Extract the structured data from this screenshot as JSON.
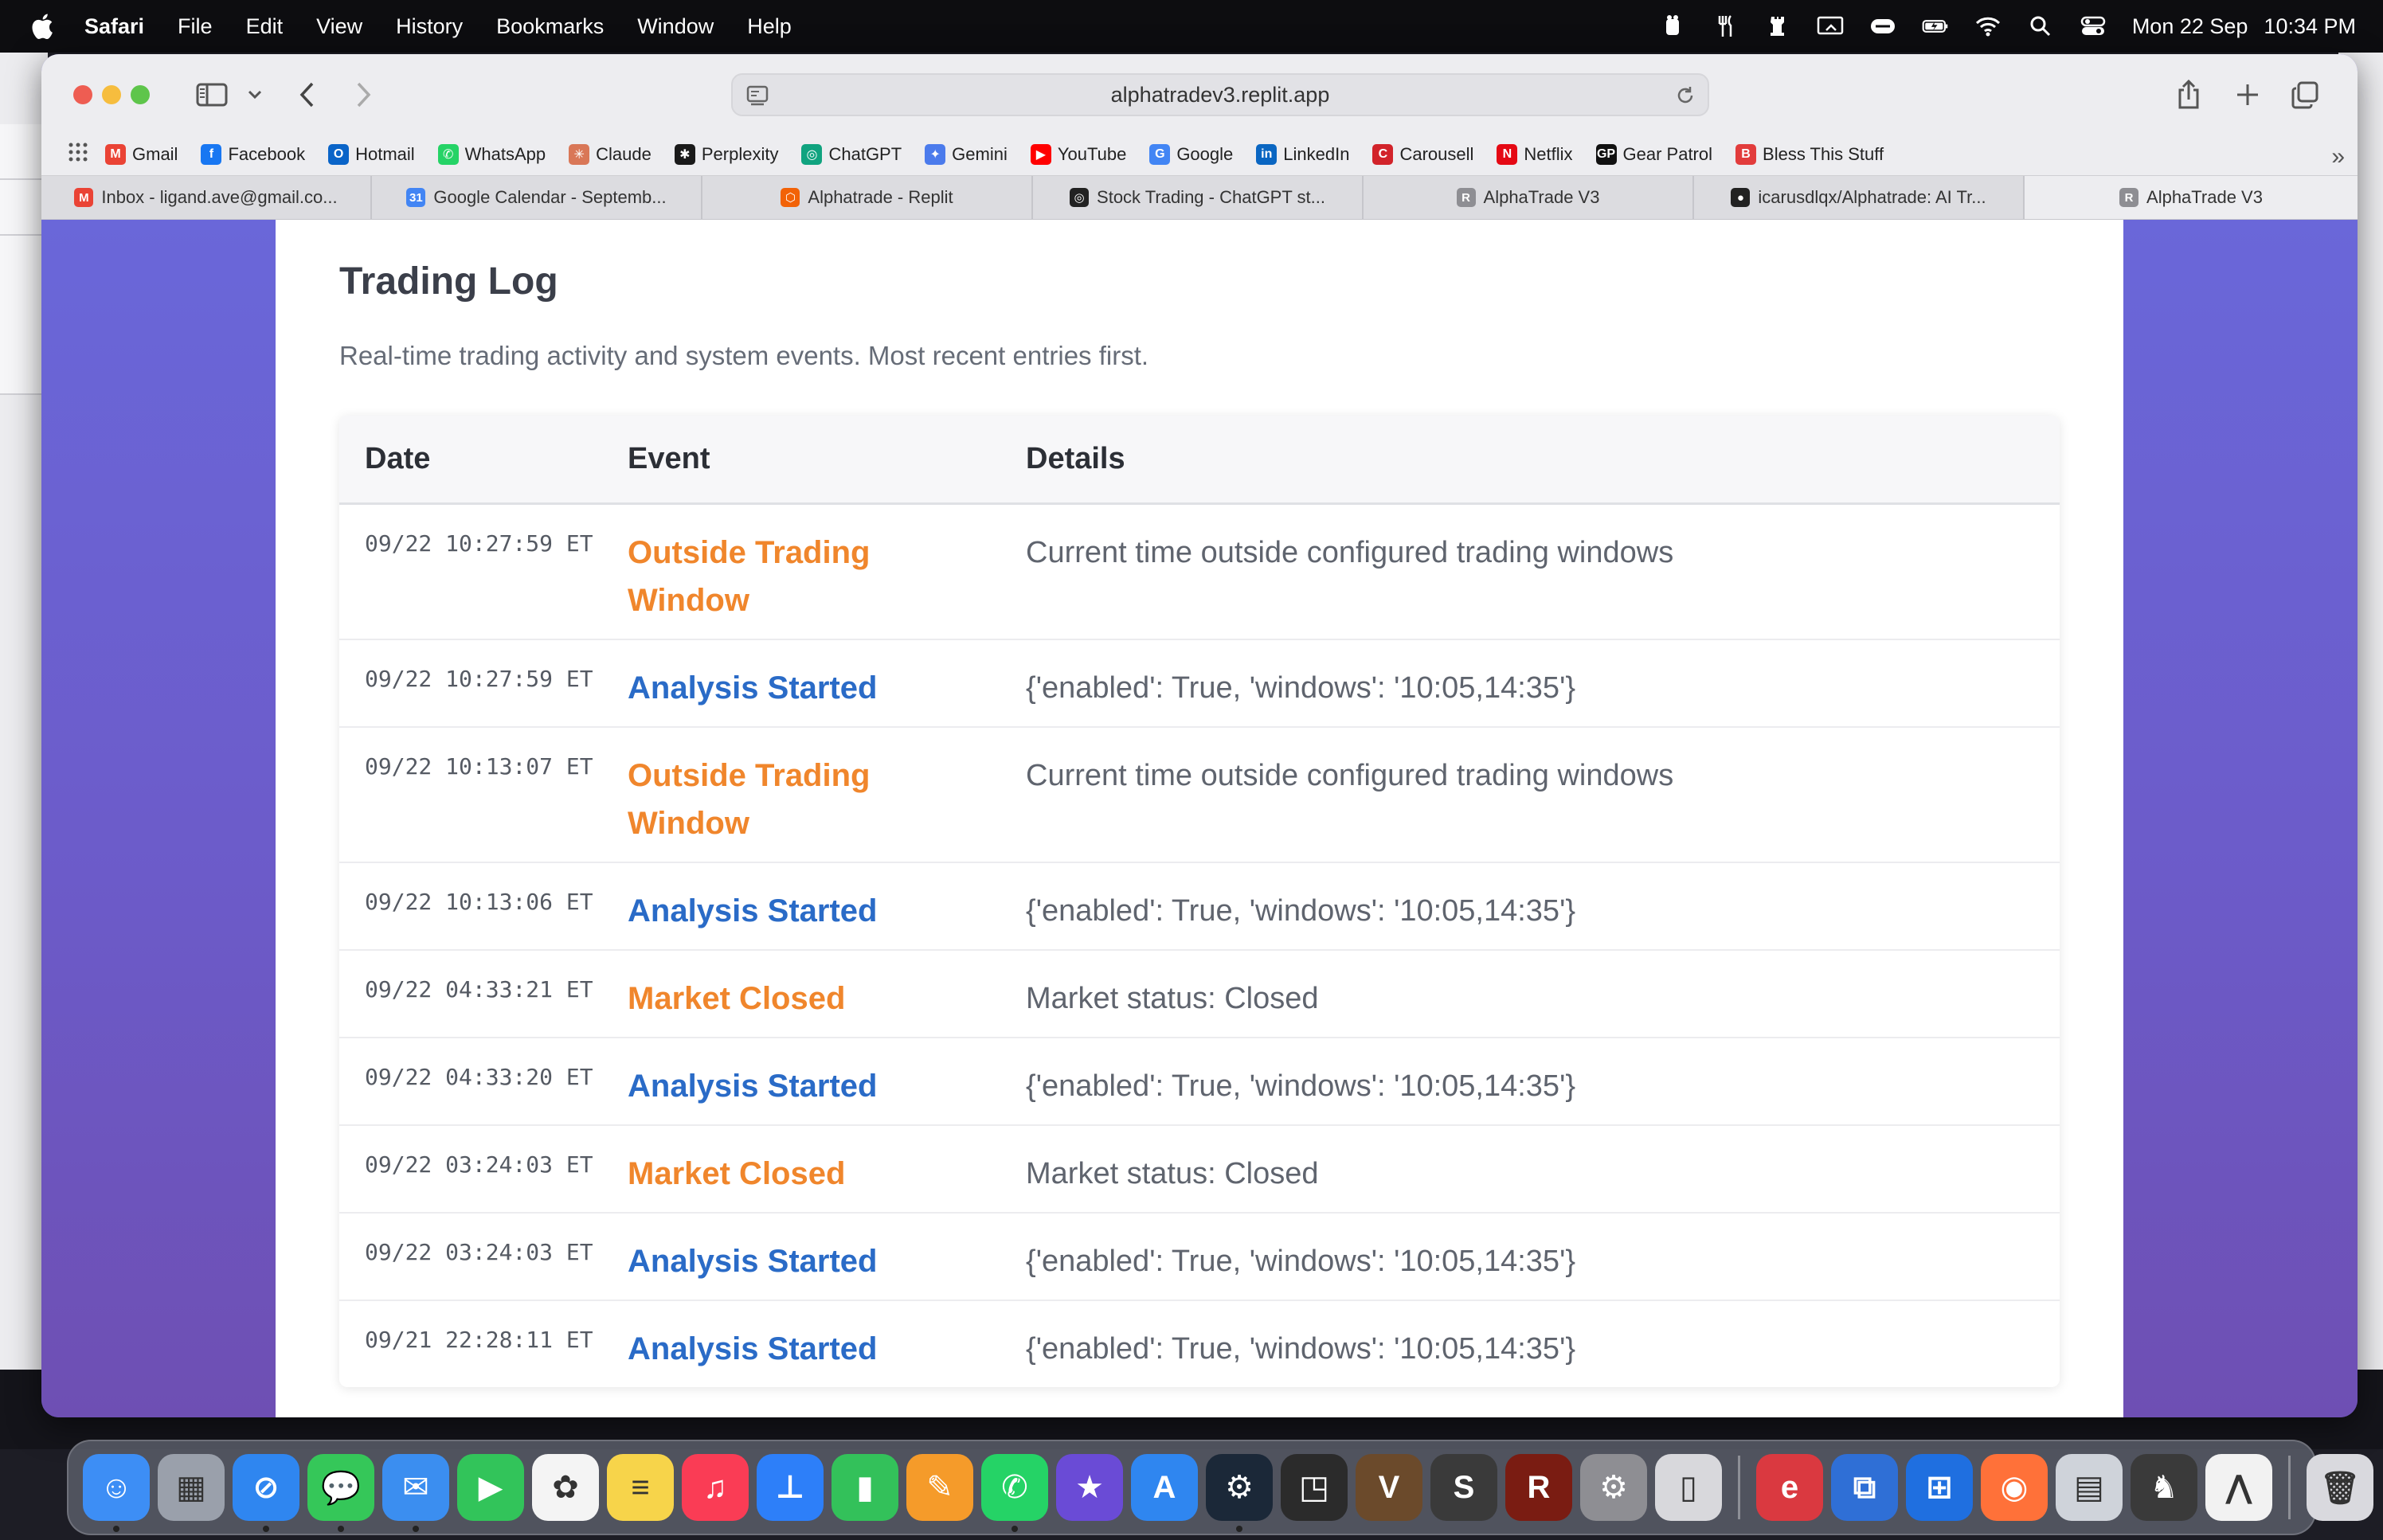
{
  "menubar": {
    "app": "Safari",
    "items": [
      "File",
      "Edit",
      "View",
      "History",
      "Bookmarks",
      "Window",
      "Help"
    ],
    "date": "Mon 22 Sep",
    "time": "10:34 PM"
  },
  "browser": {
    "url": "alphatradev3.replit.app",
    "bookmarks": [
      {
        "label": "Gmail",
        "icon": "gmail-icon",
        "color": "#ea4335",
        "glyph": "M"
      },
      {
        "label": "Facebook",
        "icon": "facebook-icon",
        "color": "#1877f2",
        "glyph": "f"
      },
      {
        "label": "Hotmail",
        "icon": "outlook-icon",
        "color": "#0a64c8",
        "glyph": "O"
      },
      {
        "label": "WhatsApp",
        "icon": "whatsapp-icon",
        "color": "#25d366",
        "glyph": "✆"
      },
      {
        "label": "Claude",
        "icon": "claude-icon",
        "color": "#d97757",
        "glyph": "✳"
      },
      {
        "label": "Perplexity",
        "icon": "perplexity-icon",
        "color": "#1a1a1a",
        "glyph": "✱"
      },
      {
        "label": "ChatGPT",
        "icon": "chatgpt-icon",
        "color": "#10a37f",
        "glyph": "◎"
      },
      {
        "label": "Gemini",
        "icon": "gemini-icon",
        "color": "#4b7bec",
        "glyph": "✦"
      },
      {
        "label": "YouTube",
        "icon": "youtube-icon",
        "color": "#ff0000",
        "glyph": "▶"
      },
      {
        "label": "Google",
        "icon": "google-icon",
        "color": "#4285f4",
        "glyph": "G"
      },
      {
        "label": "LinkedIn",
        "icon": "linkedin-icon",
        "color": "#0a66c2",
        "glyph": "in"
      },
      {
        "label": "Carousell",
        "icon": "carousell-icon",
        "color": "#d2232a",
        "glyph": "C"
      },
      {
        "label": "Netflix",
        "icon": "netflix-icon",
        "color": "#e50914",
        "glyph": "N"
      },
      {
        "label": "Gear Patrol",
        "icon": "gear-patrol-icon",
        "color": "#111111",
        "glyph": "GP"
      },
      {
        "label": "Bless This Stuff",
        "icon": "bless-this-stuff-icon",
        "color": "#e23c3c",
        "glyph": "B"
      }
    ],
    "tabs": [
      {
        "label": "Inbox - ligand.ave@gmail.co...",
        "icon": "gmail-icon",
        "color": "#ea4335",
        "glyph": "M"
      },
      {
        "label": "Google Calendar - Septemb...",
        "icon": "calendar-icon",
        "color": "#4285f4",
        "glyph": "31"
      },
      {
        "label": "Alphatrade - Replit",
        "icon": "replit-icon",
        "color": "#f26207",
        "glyph": "⬡"
      },
      {
        "label": "Stock Trading - ChatGPT st...",
        "icon": "chatgpt-icon",
        "color": "#222222",
        "glyph": "◎"
      },
      {
        "label": "AlphaTrade V3",
        "icon": "alphatrade-icon",
        "color": "#8e8e93",
        "glyph": "R"
      },
      {
        "label": "icarusdlqx/Alphatrade: AI Tr...",
        "icon": "github-icon",
        "color": "#222222",
        "glyph": "●"
      },
      {
        "label": "AlphaTrade V3",
        "icon": "alphatrade-icon",
        "color": "#8e8e93",
        "glyph": "R"
      }
    ]
  },
  "log": {
    "title": "Trading Log",
    "subtitle": "Real-time trading activity and system events. Most recent entries first.",
    "headers": {
      "date": "Date",
      "event": "Event",
      "details": "Details"
    },
    "colors": {
      "warning": "#f0862c",
      "info": "#2a6bc7"
    },
    "rows": [
      {
        "date": "09/22 10:27:59 ET",
        "event": "Outside Trading Window",
        "kind": "warning",
        "details": "Current time outside configured trading windows"
      },
      {
        "date": "09/22 10:27:59 ET",
        "event": "Analysis Started",
        "kind": "info",
        "details": "{'enabled': True, 'windows': '10:05,14:35'}"
      },
      {
        "date": "09/22 10:13:07 ET",
        "event": "Outside Trading Window",
        "kind": "warning",
        "details": "Current time outside configured trading windows"
      },
      {
        "date": "09/22 10:13:06 ET",
        "event": "Analysis Started",
        "kind": "info",
        "details": "{'enabled': True, 'windows': '10:05,14:35'}"
      },
      {
        "date": "09/22 04:33:21 ET",
        "event": "Market Closed",
        "kind": "warning",
        "details": "Market status: Closed"
      },
      {
        "date": "09/22 04:33:20 ET",
        "event": "Analysis Started",
        "kind": "info",
        "details": "{'enabled': True, 'windows': '10:05,14:35'}"
      },
      {
        "date": "09/22 03:24:03 ET",
        "event": "Market Closed",
        "kind": "warning",
        "details": "Market status: Closed"
      },
      {
        "date": "09/22 03:24:03 ET",
        "event": "Analysis Started",
        "kind": "info",
        "details": "{'enabled': True, 'windows': '10:05,14:35'}"
      },
      {
        "date": "09/21 22:28:11 ET",
        "event": "Analysis Started",
        "kind": "info",
        "details": "{'enabled': True, 'windows': '10:05,14:35'}"
      }
    ]
  },
  "dock": {
    "apps": [
      {
        "name": "finder-icon",
        "color": "#3d8ef5",
        "glyph": "☺",
        "running": true
      },
      {
        "name": "launchpad-icon",
        "color": "#9aa0ab",
        "glyph": "▦",
        "running": false
      },
      {
        "name": "safari-icon",
        "color": "#2f86f0",
        "glyph": "⊘",
        "running": true
      },
      {
        "name": "messages-icon",
        "color": "#35c759",
        "glyph": "💬",
        "running": true
      },
      {
        "name": "mail-icon",
        "color": "#3b8ef0",
        "glyph": "✉",
        "running": true
      },
      {
        "name": "facetime-icon",
        "color": "#32c45a",
        "glyph": "▶",
        "running": false
      },
      {
        "name": "photos-icon",
        "color": "#f4f4f4",
        "glyph": "✿",
        "running": false
      },
      {
        "name": "notes-icon",
        "color": "#f7d44a",
        "glyph": "≡",
        "running": false
      },
      {
        "name": "music-icon",
        "color": "#fa3c55",
        "glyph": "♫",
        "running": false
      },
      {
        "name": "keynote-icon",
        "color": "#2d7ff9",
        "glyph": "⊥",
        "running": false
      },
      {
        "name": "numbers-icon",
        "color": "#33c15a",
        "glyph": "▮",
        "running": false
      },
      {
        "name": "pages-icon",
        "color": "#f59b2a",
        "glyph": "✎",
        "running": false
      },
      {
        "name": "whatsapp-icon",
        "color": "#25d366",
        "glyph": "✆",
        "running": true
      },
      {
        "name": "imovie-icon",
        "color": "#6a4bd6",
        "glyph": "★",
        "running": false
      },
      {
        "name": "app-store-icon",
        "color": "#2f86f0",
        "glyph": "A",
        "running": false
      },
      {
        "name": "steam-icon",
        "color": "#1b2838",
        "glyph": "⚙",
        "running": true
      },
      {
        "name": "screenshot-icon",
        "color": "#2b2b2b",
        "glyph": "◳",
        "running": false
      },
      {
        "name": "vectorworks-icon",
        "color": "#6b4a2b",
        "glyph": "V",
        "running": false
      },
      {
        "name": "shogun-game-icon",
        "color": "#3a3a3a",
        "glyph": "S",
        "running": false
      },
      {
        "name": "rome-game-icon",
        "color": "#7a1c12",
        "glyph": "R",
        "running": false
      },
      {
        "name": "system-settings-icon",
        "color": "#8e8e93",
        "glyph": "⚙",
        "running": false
      },
      {
        "name": "iphone-mirroring-icon",
        "color": "#d8d8dc",
        "glyph": "▯",
        "running": false
      },
      {
        "name": "express-vpn-icon",
        "color": "#da3940",
        "glyph": "e",
        "running": false
      },
      {
        "name": "remote-desktop-icon",
        "color": "#2f6fd6",
        "glyph": "⧉",
        "running": false
      },
      {
        "name": "windows-app-icon",
        "color": "#1f6fe0",
        "glyph": "⊞",
        "running": false
      },
      {
        "name": "firefox-icon",
        "color": "#ff7139",
        "glyph": "◉",
        "running": false
      },
      {
        "name": "preview-icon",
        "color": "#cfd3da",
        "glyph": "▤",
        "running": false
      },
      {
        "name": "game-icon",
        "color": "#3a3a3a",
        "glyph": "♞",
        "running": false
      },
      {
        "name": "arc-icon",
        "color": "#f2f2f2",
        "glyph": "⋀",
        "running": false
      },
      {
        "name": "trash-icon",
        "color": "#d9d9de",
        "glyph": "🗑",
        "running": false
      }
    ]
  }
}
